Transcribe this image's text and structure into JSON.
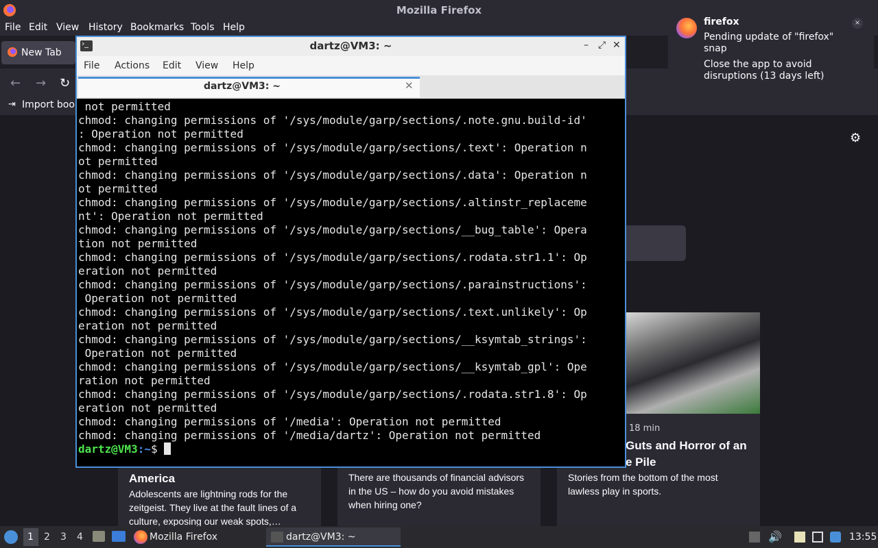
{
  "firefox": {
    "window_title": "Mozilla Firefox",
    "menu": [
      "File",
      "Edit",
      "View",
      "History",
      "Bookmarks",
      "Tools",
      "Help"
    ],
    "tab_label": "New Tab",
    "bookmark_label": "Import book",
    "cards": [
      {
        "title": "America",
        "text": "Adolescents are lightning rods for the zeitgeist. They live at the fault lines of a culture, exposing our weak spots,…"
      },
      {
        "text": "There are thousands of financial advisors in the US – how do you avoid mistakes when hiring one?"
      },
      {
        "meta": "18 min",
        "title_line1": "Guts and Horror of an",
        "title_line2": "e Pile",
        "text": "Stories from the bottom of the most lawless play in sports."
      }
    ]
  },
  "terminal": {
    "window_title": "dartz@VM3: ~",
    "menu": [
      "File",
      "Actions",
      "Edit",
      "View",
      "Help"
    ],
    "tab_label": "dartz@VM3: ~",
    "lines": [
      " not permitted",
      "chmod: changing permissions of '/sys/module/garp/sections/.note.gnu.build-id'",
      ": Operation not permitted",
      "chmod: changing permissions of '/sys/module/garp/sections/.text': Operation n",
      "ot permitted",
      "chmod: changing permissions of '/sys/module/garp/sections/.data': Operation n",
      "ot permitted",
      "chmod: changing permissions of '/sys/module/garp/sections/.altinstr_replaceme",
      "nt': Operation not permitted",
      "chmod: changing permissions of '/sys/module/garp/sections/__bug_table': Opera",
      "tion not permitted",
      "chmod: changing permissions of '/sys/module/garp/sections/.rodata.str1.1': Op",
      "eration not permitted",
      "chmod: changing permissions of '/sys/module/garp/sections/.parainstructions':",
      " Operation not permitted",
      "chmod: changing permissions of '/sys/module/garp/sections/.text.unlikely': Op",
      "eration not permitted",
      "chmod: changing permissions of '/sys/module/garp/sections/__ksymtab_strings':",
      " Operation not permitted",
      "chmod: changing permissions of '/sys/module/garp/sections/__ksymtab_gpl': Ope",
      "ration not permitted",
      "chmod: changing permissions of '/sys/module/garp/sections/.rodata.str1.8': Op",
      "eration not permitted",
      "chmod: changing permissions of '/media': Operation not permitted",
      "chmod: changing permissions of '/media/dartz': Operation not permitted"
    ],
    "prompt_user": "dartz@VM3",
    "prompt_path": ":~",
    "prompt_symbol": "$ "
  },
  "notification": {
    "app": "firefox",
    "body_line1": "Pending update of \"firefox\" snap",
    "body_line2": "Close the app to avoid disruptions (13 days left)",
    "close_glyph": "×"
  },
  "taskbar": {
    "workspaces": [
      "1",
      "2",
      "3",
      "4"
    ],
    "tasks": [
      "Mozilla Firefox",
      "dartz@VM3: ~"
    ],
    "clock": "13:55"
  },
  "icons": {
    "back": "back-arrow-icon",
    "forward": "forward-arrow-icon",
    "reload": "reload-icon",
    "settings": "gear-icon",
    "terminal": "terminal-icon",
    "firefox": "firefox-logo-icon"
  }
}
